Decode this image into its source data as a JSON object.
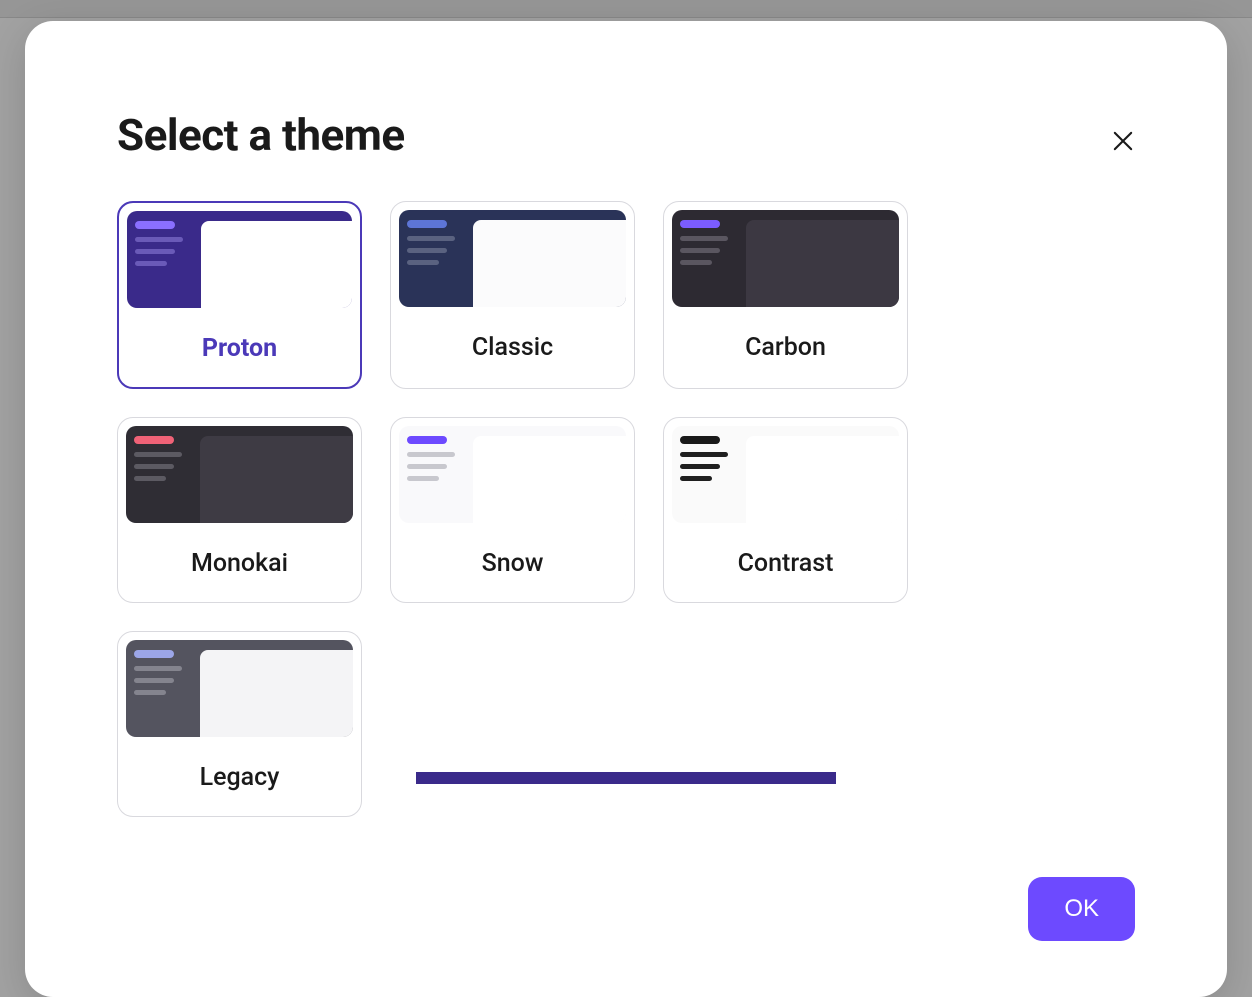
{
  "modal": {
    "title": "Select a theme",
    "ok_label": "OK"
  },
  "themes": [
    {
      "id": "proton",
      "label": "Proton",
      "selected": true,
      "bg": "#3a2a8a",
      "accent": "#8a6fff",
      "line": "#6a5ab8",
      "content": "#ffffff"
    },
    {
      "id": "classic",
      "label": "Classic",
      "selected": false,
      "bg": "#2a3358",
      "accent": "#5d75d6",
      "line": "#5a6280",
      "content": "#fbfbfc"
    },
    {
      "id": "carbon",
      "label": "Carbon",
      "selected": false,
      "bg": "#2d2a32",
      "accent": "#7b5cff",
      "line": "#5a5660",
      "content": "#3c3842"
    },
    {
      "id": "monokai",
      "label": "Monokai",
      "selected": false,
      "bg": "#2f2d34",
      "accent": "#f06277",
      "line": "#5c5a62",
      "content": "#3e3b44"
    },
    {
      "id": "snow",
      "label": "Snow",
      "selected": false,
      "bg": "#f9f9fb",
      "accent": "#6d4aff",
      "line": "#c8c8ce",
      "content": "#ffffff"
    },
    {
      "id": "contrast",
      "label": "Contrast",
      "selected": false,
      "bg": "#fafafa",
      "accent": "#1a1a1a",
      "line": "#1f1f1f",
      "content": "#ffffff"
    },
    {
      "id": "legacy",
      "label": "Legacy",
      "selected": false,
      "bg": "#54545f",
      "accent": "#9ca6e8",
      "line": "#84848e",
      "content": "#f4f4f6"
    }
  ]
}
